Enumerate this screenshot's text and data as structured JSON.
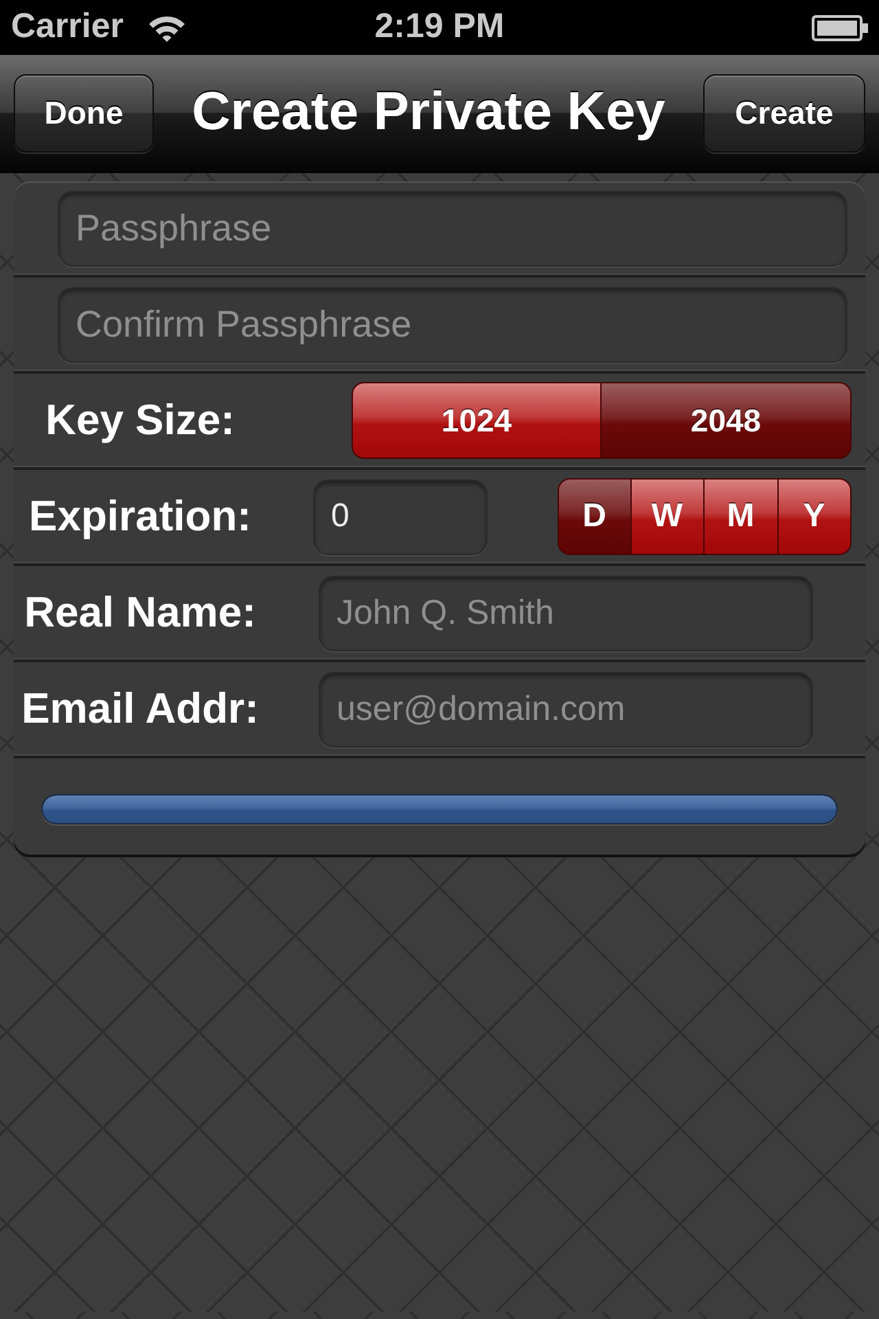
{
  "status_bar": {
    "carrier": "Carrier",
    "time": "2:19 PM"
  },
  "nav_bar": {
    "left_button": "Done",
    "title": "Create Private Key",
    "right_button": "Create"
  },
  "form": {
    "rows": [
      {
        "kind": "field",
        "placeholder": "Passphrase"
      },
      {
        "kind": "field",
        "placeholder": "Confirm Passphrase"
      },
      {
        "kind": "segmented",
        "label": "Key Size:",
        "segments": [
          {
            "label": "1024",
            "selected": false
          },
          {
            "label": "2048",
            "selected": true
          }
        ]
      },
      {
        "kind": "value_segmented",
        "label": "Expiration:",
        "value": "0",
        "segments": [
          {
            "label": "D",
            "selected": true
          },
          {
            "label": "W",
            "selected": false
          },
          {
            "label": "M",
            "selected": false
          },
          {
            "label": "Y",
            "selected": false
          }
        ]
      },
      {
        "kind": "labeled_field",
        "label": "Real Name:",
        "placeholder": "John Q. Smith"
      },
      {
        "kind": "labeled_field",
        "label": "Email Addr:",
        "placeholder": "user@domain.com"
      },
      {
        "kind": "progress",
        "level": 1
      }
    ]
  }
}
